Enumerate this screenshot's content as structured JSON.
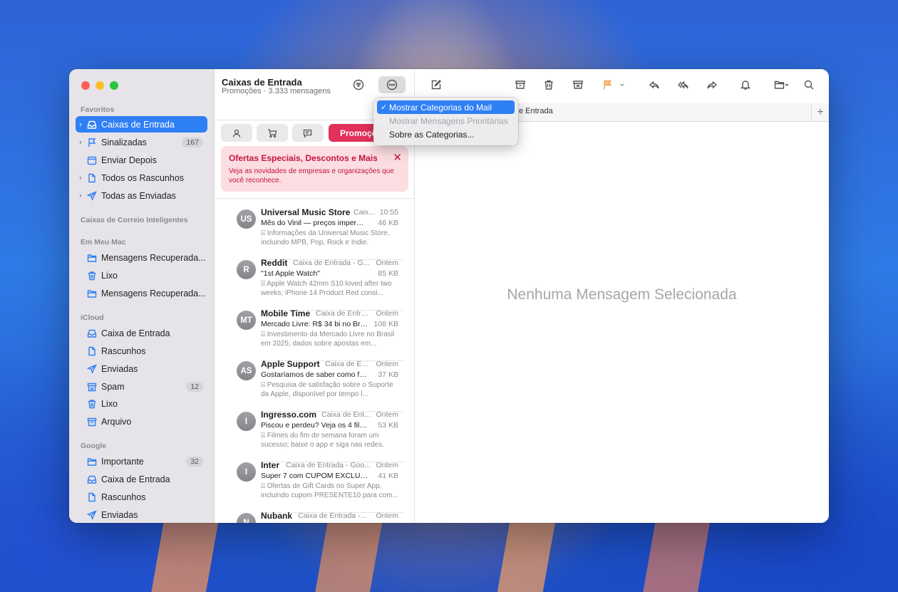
{
  "sidebar": {
    "sections": {
      "favoritos": "Favoritos",
      "inteligentes": "Caixas de Correio Inteligentes",
      "meu_mac": "Em Meu Mac",
      "icloud": "iCloud",
      "google": "Google"
    },
    "favoritos": [
      {
        "label": "Caixas de Entrada",
        "icon": "tray-icon",
        "badge": ""
      },
      {
        "label": "Sinalizadas",
        "icon": "flag-icon",
        "badge": "167"
      },
      {
        "label": "Enviar Depois",
        "icon": "calendar-icon",
        "badge": ""
      },
      {
        "label": "Todos os Rascunhos",
        "icon": "document-icon",
        "badge": ""
      },
      {
        "label": "Todas as Enviadas",
        "icon": "paperplane-icon",
        "badge": ""
      }
    ],
    "meu_mac": [
      {
        "label": "Mensagens Recuperada...",
        "icon": "folder-icon"
      },
      {
        "label": "Lixo",
        "icon": "trash-icon"
      },
      {
        "label": "Mensagens Recuperada...",
        "icon": "folder-icon"
      }
    ],
    "icloud": [
      {
        "label": "Caixa de Entrada",
        "icon": "tray-icon",
        "badge": ""
      },
      {
        "label": "Rascunhos",
        "icon": "document-icon",
        "badge": ""
      },
      {
        "label": "Enviadas",
        "icon": "paperplane-icon",
        "badge": ""
      },
      {
        "label": "Spam",
        "icon": "junk-icon",
        "badge": "12"
      },
      {
        "label": "Lixo",
        "icon": "trash-icon",
        "badge": ""
      },
      {
        "label": "Arquivo",
        "icon": "archive-icon",
        "badge": ""
      }
    ],
    "google": [
      {
        "label": "Importante",
        "icon": "folder-icon",
        "badge": "32"
      },
      {
        "label": "Caixa de Entrada",
        "icon": "tray-icon",
        "badge": ""
      },
      {
        "label": "Rascunhos",
        "icon": "document-icon",
        "badge": ""
      },
      {
        "label": "Enviadas",
        "icon": "paperplane-icon",
        "badge": ""
      }
    ]
  },
  "list": {
    "title": "Caixas de Entrada",
    "subtitle": "Promoções · 3.333 mensagens",
    "promo_tab_label": "Promoções",
    "promo_card": {
      "title": "Ofertas Especiais, Descontos e Mais",
      "text": "Veja as novidades de empresas e organizações que você reconhece."
    },
    "messages": [
      {
        "initials": "US",
        "from": "Universal Music Store",
        "mailbox": "Caix...",
        "time": "10:55",
        "subject": "Mês do Vinil — preços imperdíveis",
        "size": "46 KB",
        "preview": "Informações da Universal Music Store, incluindo MPB, Pop, Rock e Indie."
      },
      {
        "initials": "R",
        "from": "Reddit",
        "mailbox": "Caixa de Entrada - G...",
        "time": "Ontem",
        "subject": "\"1st Apple Watch\"",
        "size": "85 KB",
        "preview": "Apple Watch 42mm S10 loved after two weeks; iPhone 14 Product Red consi..."
      },
      {
        "initials": "MT",
        "from": "Mobile Time",
        "mailbox": "Caixa de Entra...",
        "time": "Ontem",
        "subject": "Mercado Livre: R$ 34 bi no Bra...",
        "size": "108 KB",
        "preview": "Investimento da Mercado Livre no Brasil em 2025; dados sobre apostas em..."
      },
      {
        "initials": "AS",
        "from": "Apple Support",
        "mailbox": "Caixa de En...",
        "time": "Ontem",
        "subject": "Gostaríamos de saber como foi...",
        "size": "37 KB",
        "preview": "Pesquisa de satisfação sobre o Suporte da Apple, disponível por tempo l..."
      },
      {
        "initials": "I",
        "from": "Ingresso.com",
        "mailbox": "Caixa de Ent...",
        "time": "Ontem",
        "subject": "Piscou e perdeu? Veja os 4 film...",
        "size": "53 KB",
        "preview": "Filmes do fim de semana foram um sucesso; baixe o app e siga nas redes."
      },
      {
        "initials": "I",
        "from": "Inter",
        "mailbox": "Caixa de Entrada - Goo...",
        "time": "Ontem",
        "subject": "Super 7 com CUPOM EXCLUSIV...",
        "size": "41 KB",
        "preview": "Ofertas de Gift Cards no Super App, incluindo cupom PRESENTE10 para com..."
      },
      {
        "initials": "N",
        "from": "Nubank",
        "mailbox": "Caixa de Entrada -...",
        "time": "Ontem",
        "subject": "",
        "size": "",
        "preview": ""
      }
    ]
  },
  "menu": {
    "items": [
      {
        "label": "Mostrar Categorias do Mail",
        "checked": "✓"
      },
      {
        "label": "Mostrar Mensagens Prioritárias",
        "checked": ""
      },
      {
        "label": "Sobre as Categorias...",
        "checked": ""
      }
    ]
  },
  "content": {
    "tab_label": "e Entrada",
    "empty_text": "Nenhuma Mensagem Selecionada"
  },
  "colors": {
    "accent": "#2f7ff5",
    "promo": "#e0315a",
    "promo_card_bg": "#fbdde2"
  }
}
